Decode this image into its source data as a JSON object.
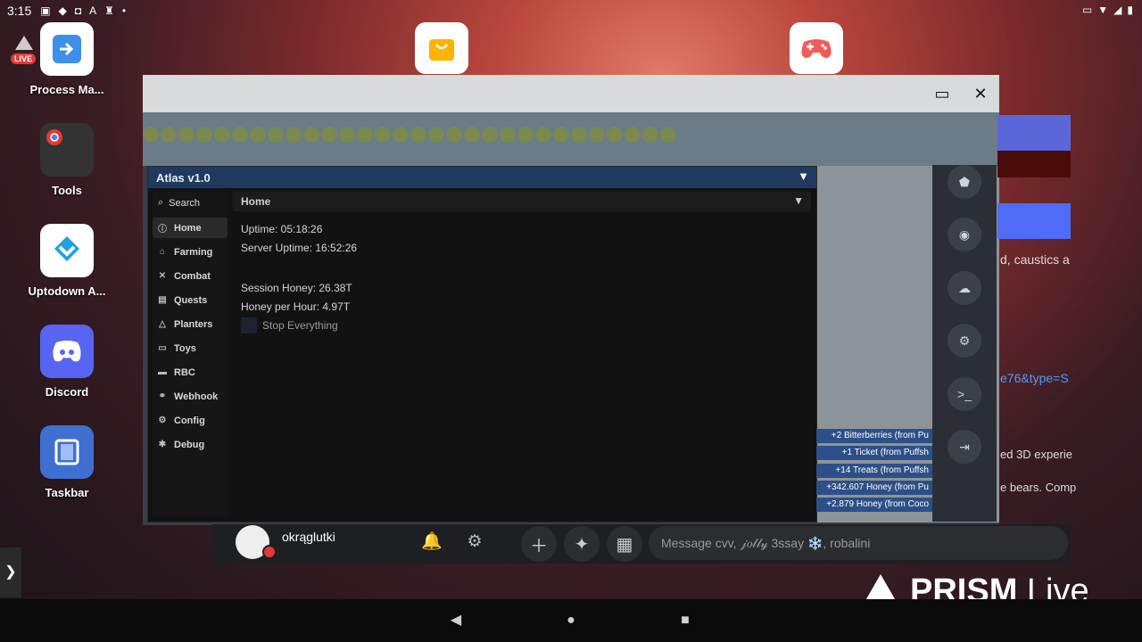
{
  "statusbar": {
    "time": "3:15",
    "left_icons": [
      "hd-icon",
      "app-icon",
      "vpn-icon",
      "text-icon",
      "usb-icon",
      "dot-icon"
    ],
    "right_icons": [
      "cast-icon",
      "wifi-icon",
      "signal-icon",
      "battery-icon"
    ]
  },
  "live_badge": {
    "label": "LIVE"
  },
  "desktop": {
    "icons": [
      {
        "label": "Process Ma...",
        "icon": "process-manager-icon"
      },
      {
        "label": "Tools",
        "icon": "chrome-icon"
      },
      {
        "label": "Uptodown A...",
        "icon": "uptodown-icon"
      },
      {
        "label": "Discord",
        "icon": "discord-icon"
      },
      {
        "label": "Taskbar",
        "icon": "taskbar-icon"
      }
    ]
  },
  "window": {
    "controls": {
      "maximize": "▭",
      "close": "✕"
    }
  },
  "atlas": {
    "title": "Atlas v1.0",
    "search_label": "Search",
    "nav": [
      {
        "label": "Home",
        "icon": "info-icon"
      },
      {
        "label": "Farming",
        "icon": "home-icon"
      },
      {
        "label": "Combat",
        "icon": "swords-icon"
      },
      {
        "label": "Quests",
        "icon": "quest-icon"
      },
      {
        "label": "Planters",
        "icon": "planter-icon"
      },
      {
        "label": "Toys",
        "icon": "toy-icon"
      },
      {
        "label": "RBC",
        "icon": "rbc-icon"
      },
      {
        "label": "Webhook",
        "icon": "webhook-icon"
      },
      {
        "label": "Config",
        "icon": "config-icon"
      },
      {
        "label": "Debug",
        "icon": "debug-icon"
      }
    ],
    "content": {
      "section": "Home",
      "uptime": "Uptime: 05:18:26",
      "server_uptime": "Server Uptime: 16:52:26",
      "session_honey": "Session Honey: 26.38T",
      "honey_per_hour": "Honey per Hour: 4.97T",
      "stop_label": "Stop Everything"
    }
  },
  "notifications": [
    "+2 Bitterberries (from Pu",
    "+1 Ticket (from Puffsh",
    "+14 Treats (from Puffsh",
    "+342.607 Honey (from Pu",
    "+2.879 Honey (from Coco"
  ],
  "behind": {
    "text1": "d, caustics a",
    "link": "e76&type=S",
    "text2": "ed 3D experie",
    "text3": "e bears. Comp"
  },
  "discord": {
    "username": "okrąglutki",
    "message_placeholder": "Message cvv, 𝒿𝑜𝓁𝓁𝓎 3ssay ❄️, robalini"
  },
  "prism": {
    "brand": "PRISM",
    "suffix": "Live"
  }
}
